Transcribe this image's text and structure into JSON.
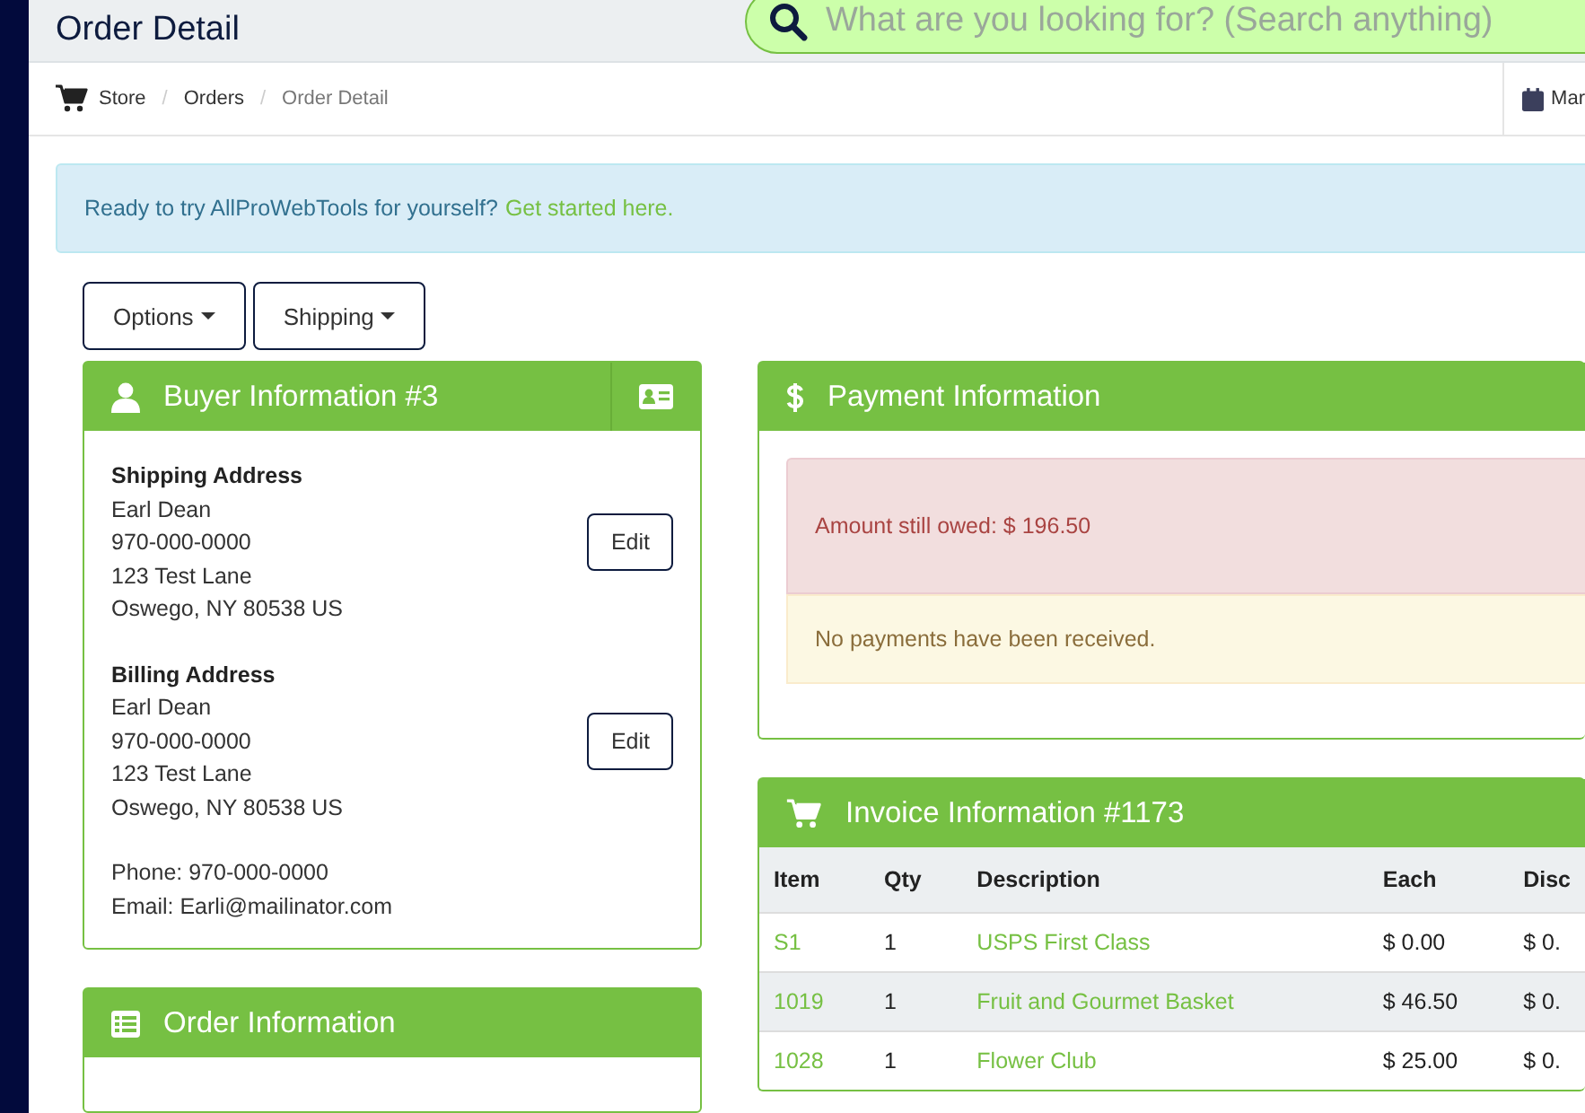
{
  "header": {
    "title": "Order Detail",
    "search": {
      "placeholder": "What are you looking for? (Search anything)"
    }
  },
  "breadcrumb": [
    {
      "label": "Store",
      "kind": "link"
    },
    {
      "separator": "/",
      "label": "Orders",
      "kind": "link"
    },
    {
      "separator": "/",
      "label": "Order Detail",
      "kind": "current"
    }
  ],
  "date_button": {
    "label": "Mar"
  },
  "alert": {
    "text": "Ready to try AllProWebTools for yourself?",
    "link": "Get started here."
  },
  "toolbar": [
    "Options",
    "Shipping"
  ],
  "buyer": {
    "title": "Buyer Information #3",
    "addresses": [
      {
        "heading": "Shipping Address",
        "lines": [
          "Earl Dean",
          "970-000-0000",
          "123 Test Lane",
          "Oswego, NY 80538 US"
        ],
        "button": "Edit"
      },
      {
        "heading": "Billing Address",
        "lines": [
          "Earl Dean",
          "970-000-0000",
          "123 Test Lane",
          "Oswego, NY 80538 US"
        ],
        "button": "Edit"
      }
    ],
    "phone": "Phone: 970-000-0000",
    "email": "Email: Earli@mailinator.com"
  },
  "order_info": {
    "title": "Order Information"
  },
  "payment": {
    "title": "Payment Information",
    "owed": "Amount still owed: $ 196.50",
    "note": "No payments have been received."
  },
  "invoice": {
    "title": "Invoice Information #1173",
    "columns": [
      "Item",
      "Qty",
      "Description",
      "Each",
      "Disc"
    ],
    "rows": [
      {
        "item": "S1",
        "qty": "1",
        "description": "USPS First Class",
        "each": "$ 0.00",
        "disc": "$ 0."
      },
      {
        "item": "1019",
        "qty": "1",
        "description": "Fruit and Gourmet Basket",
        "each": "$ 46.50",
        "disc": "$ 0."
      },
      {
        "item": "1028",
        "qty": "1",
        "description": "Flower Club",
        "each": "$ 25.00",
        "disc": "$ 0."
      }
    ]
  }
}
